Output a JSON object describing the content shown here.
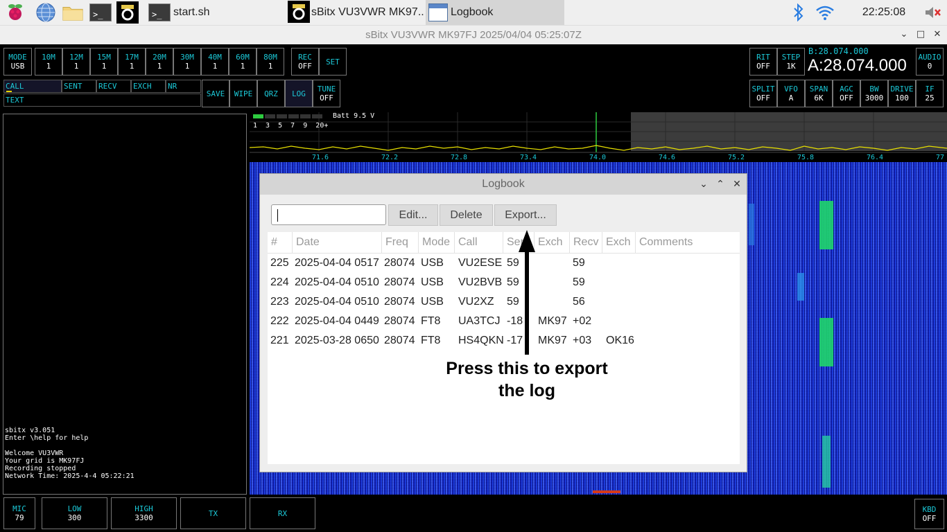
{
  "taskbar": {
    "tasks": [
      {
        "label": "start.sh"
      },
      {
        "label": "sBitx VU3VWR MK97..."
      },
      {
        "label": "Logbook"
      }
    ],
    "clock": "22:25:08"
  },
  "window": {
    "title": "sBitx VU3VWR MK97FJ 2025/04/04 05:25:07Z"
  },
  "top_row": {
    "mode": {
      "label": "MODE",
      "value": "USB"
    },
    "bands": [
      {
        "label": "10M",
        "value": "1"
      },
      {
        "label": "12M",
        "value": "1"
      },
      {
        "label": "15M",
        "value": "1"
      },
      {
        "label": "17M",
        "value": "1"
      },
      {
        "label": "20M",
        "value": "1"
      },
      {
        "label": "30M",
        "value": "1"
      },
      {
        "label": "40M",
        "value": "1"
      },
      {
        "label": "60M",
        "value": "1"
      },
      {
        "label": "80M",
        "value": "1"
      }
    ],
    "rec": {
      "label": "REC",
      "value": "OFF"
    },
    "set": {
      "label": "SET"
    },
    "rit": {
      "label": "RIT",
      "value": "OFF"
    },
    "step": {
      "label": "STEP",
      "value": "1K"
    },
    "vfo_b": "B:28.074.000",
    "vfo_a": "A:28.074.000",
    "audio": {
      "label": "AUDIO",
      "value": "0"
    }
  },
  "second_row": {
    "fields": {
      "call": "CALL",
      "sent": "SENT",
      "recv": "RECV",
      "exch": "EXCH",
      "nr": "NR",
      "text": "TEXT"
    },
    "buttons": {
      "save": "SAVE",
      "wipe": "WIPE",
      "qrz": "QRZ",
      "log": "LOG"
    },
    "tune": {
      "label": "TUNE",
      "value": "OFF"
    },
    "split": {
      "label": "SPLIT",
      "value": "OFF"
    },
    "vfo": {
      "label": "VFO",
      "value": "A"
    },
    "span": {
      "label": "SPAN",
      "value": "6K"
    },
    "agc": {
      "label": "AGC",
      "value": "OFF"
    },
    "bw": {
      "label": "BW",
      "value": "3000"
    },
    "drive": {
      "label": "DRIVE",
      "value": "100"
    },
    "if": {
      "label": "IF",
      "value": "25"
    }
  },
  "console": {
    "lines": "sbitx v3.051\nEnter \\help for help\n\nWelcome VU3VWR\nYour grid is MK97FJ\nRecording stopped\nNetwork Time: 2025-4-4 05:22:21"
  },
  "spectrum": {
    "batt": "Batt 9.5 V",
    "smeter_scale": "1  3  5  7  9  20+",
    "freq_ticks": [
      "71.6",
      "72.2",
      "72.8",
      "73.4",
      "74.0",
      "74.6",
      "75.2",
      "75.8",
      "76.4",
      "77"
    ]
  },
  "bottom": {
    "mic": {
      "label": "MIC",
      "value": "79"
    },
    "low": {
      "label": "LOW",
      "value": "300"
    },
    "high": {
      "label": "HIGH",
      "value": "3300"
    },
    "tx": "TX",
    "rx": "RX",
    "kbd": {
      "label": "KBD",
      "value": "OFF"
    }
  },
  "logbook": {
    "title": "Logbook",
    "buttons": {
      "edit": "Edit...",
      "delete": "Delete",
      "export": "Export..."
    },
    "columns": [
      "#",
      "Date",
      "Freq",
      "Mode",
      "Call",
      "Sent",
      "Exch",
      "Recv",
      "Exch",
      "Comments"
    ],
    "rows": [
      {
        "num": "225",
        "date": "2025-04-04 0517",
        "freq": "28074",
        "mode": "USB",
        "call": "VU2ESE",
        "sent": "59",
        "exch": "",
        "recv": "59",
        "exch2": "",
        "comments": ""
      },
      {
        "num": "224",
        "date": "2025-04-04 0510",
        "freq": "28074",
        "mode": "USB",
        "call": "VU2BVB",
        "sent": "59",
        "exch": "",
        "recv": "59",
        "exch2": "",
        "comments": ""
      },
      {
        "num": "223",
        "date": "2025-04-04 0510",
        "freq": "28074",
        "mode": "USB",
        "call": "VU2XZ",
        "sent": "59",
        "exch": "",
        "recv": "56",
        "exch2": "",
        "comments": ""
      },
      {
        "num": "222",
        "date": "2025-04-04 0449",
        "freq": "28074",
        "mode": "FT8",
        "call": "UA3TCJ",
        "sent": "-18",
        "exch": "MK97",
        "recv": "+02",
        "exch2": "",
        "comments": ""
      },
      {
        "num": "221",
        "date": "2025-03-28 0650",
        "freq": "28074",
        "mode": "FT8",
        "call": "HS4QKN",
        "sent": "-17",
        "exch": "MK97",
        "recv": "+03",
        "exch2": "OK16",
        "comments": ""
      }
    ],
    "annotation_line1": "Press this to export",
    "annotation_line2": "the log"
  }
}
